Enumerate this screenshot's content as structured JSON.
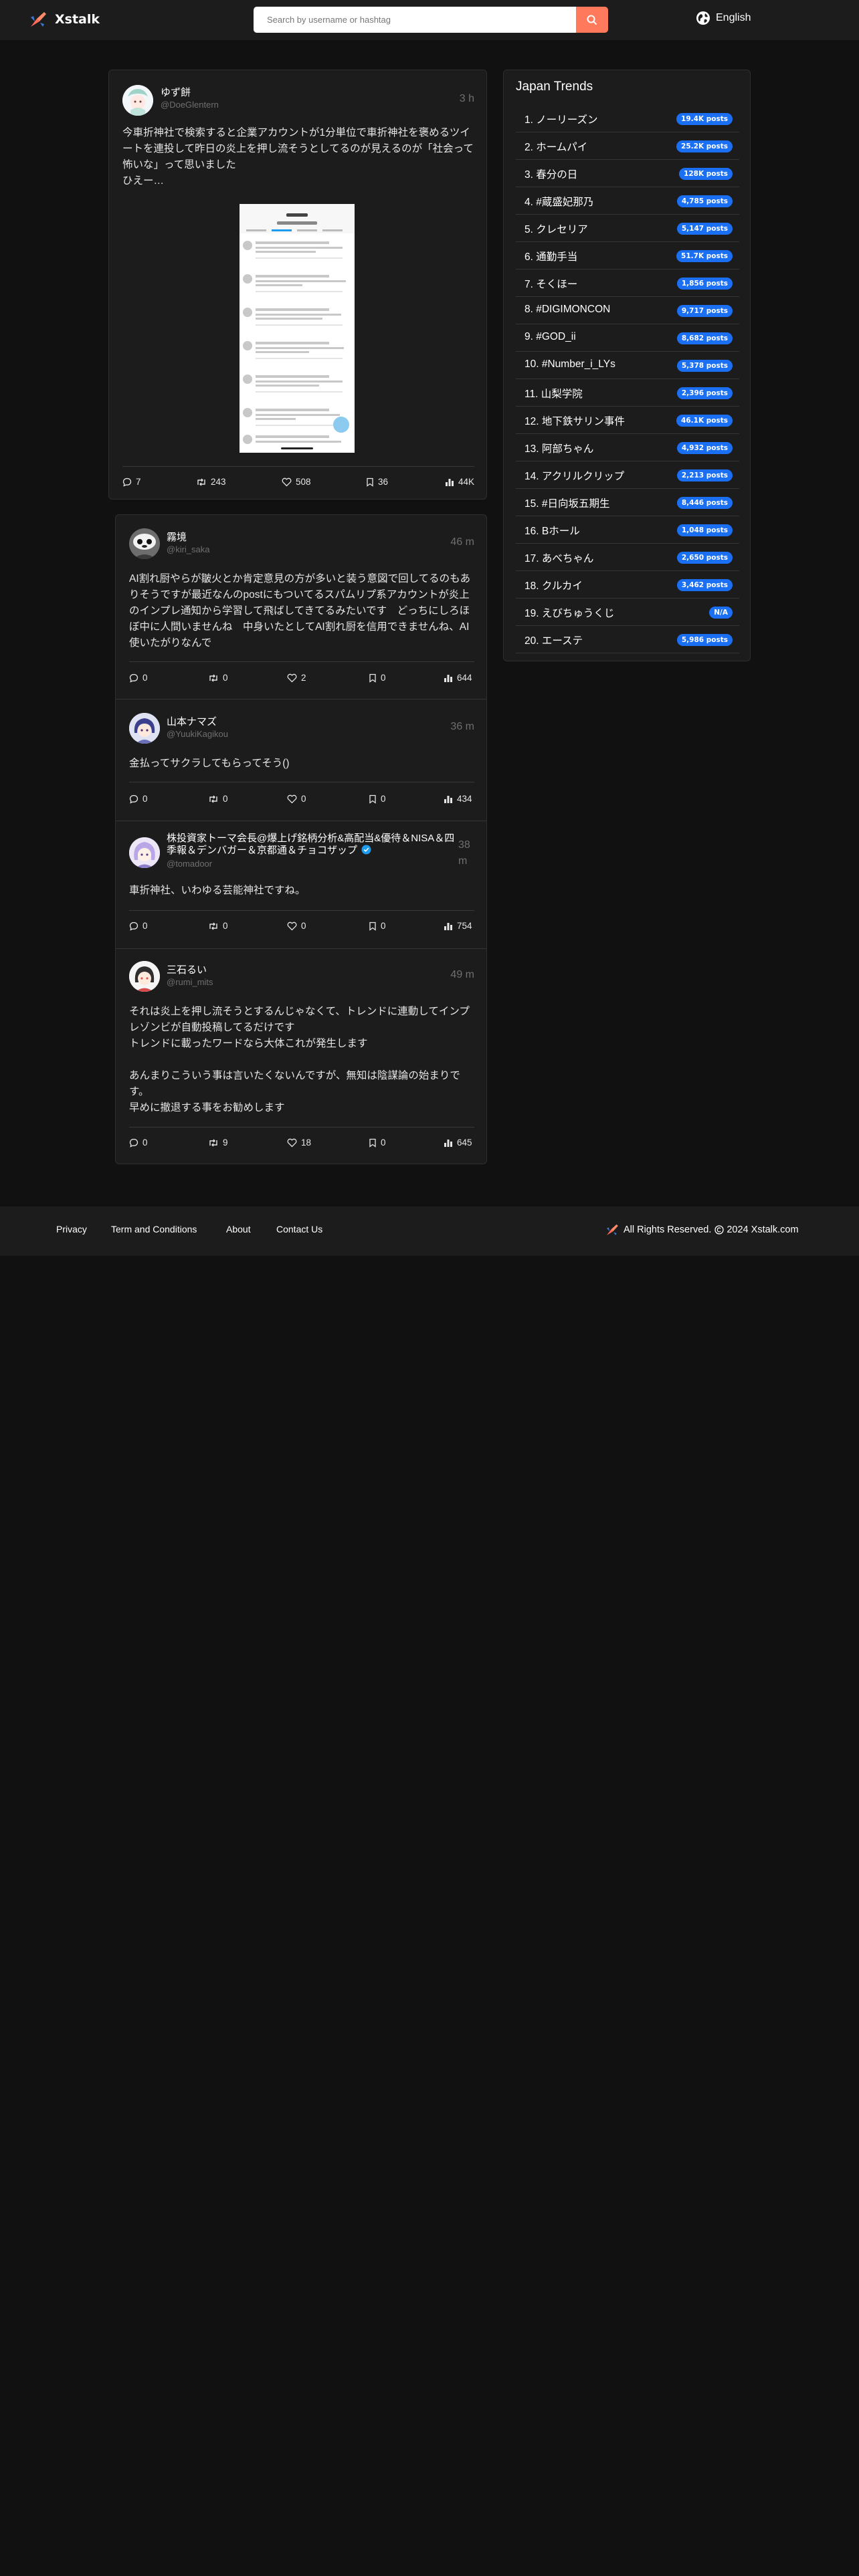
{
  "header": {
    "brand": "Xstalk",
    "search_placeholder": "Search by username or hashtag",
    "language": "English"
  },
  "posts": [
    {
      "name": "ゆず餅",
      "handle": "@DoeGlentern",
      "time": "3 h",
      "text": "今車折神社で検索すると企業アカウントが1分単位で車折神社を褒めるツイートを連投して昨日の炎上を押し流そうとしてるのが見えるのが「社会って怖いな」って思いました\nひえー…",
      "stats": {
        "replies": "7",
        "reposts": "243",
        "likes": "508",
        "bookmarks": "36",
        "views": "44K"
      }
    },
    {
      "name": "霧境",
      "handle": "@kiri_saka",
      "time": "46 m",
      "text": "AI割れ厨やらが皺火とか肯定意見の方が多いと装う意図で回してるのもありそうですが最近なんのpostにもついてるスパムリプ系アカウントが炎上のインプレ通知から学習して飛ばしてきてるみたいです　どっちにしろほぼ中に人間いませんね　中身いたとしてAI割れ厨を信用できませんね、AI使いたがりなんで",
      "stats": {
        "replies": "0",
        "reposts": "0",
        "likes": "2",
        "bookmarks": "0",
        "views": "644"
      }
    },
    {
      "name": "山本ナマズ",
      "handle": "@YuukiKagikou",
      "time": "36 m",
      "text": "金払ってサクラしてもらってそう()",
      "stats": {
        "replies": "0",
        "reposts": "0",
        "likes": "0",
        "bookmarks": "0",
        "views": "434"
      }
    },
    {
      "name": "株投資家トーマ会長@爆上げ銘柄分析&高配当&優待＆NISA＆四季報＆デンバガー＆京都通＆チョコザップ",
      "handle": "@tomadoor",
      "time": "38 m",
      "text": "車折神社、いわゆる芸能神社ですね。",
      "stats": {
        "replies": "0",
        "reposts": "0",
        "likes": "0",
        "bookmarks": "0",
        "views": "754"
      }
    },
    {
      "name": "三石るい",
      "handle": "@rumi_mits",
      "time": "49 m",
      "text": "それは炎上を押し流そうとするんじゃなくて、トレンドに連動してインプレゾンビが自動投稿してるだけです\nトレンドに載ったワードなら大体これが発生します\n\nあんまりこういう事は言いたくないんですが、無知は陰謀論の始まりです。\n早めに撤退する事をお勧めします",
      "stats": {
        "replies": "0",
        "reposts": "9",
        "likes": "18",
        "bookmarks": "0",
        "views": "645"
      }
    }
  ],
  "trends": {
    "title": "Japan Trends",
    "items": [
      {
        "label": "1. ノーリーズン",
        "count": "19.4K posts"
      },
      {
        "label": "2. ホームパイ",
        "count": "25.2K posts"
      },
      {
        "label": "3. 春分の日",
        "count": "128K posts"
      },
      {
        "label": "4. #蔵盛妃那乃",
        "count": "4,785 posts"
      },
      {
        "label": "5. クレセリア",
        "count": "5,147 posts"
      },
      {
        "label": "6. 通勤手当",
        "count": "51.7K posts"
      },
      {
        "label": "7. そくほー",
        "count": "1,856 posts"
      },
      {
        "label": "8. #DIGIMONCON",
        "count": "9,717 posts"
      },
      {
        "label": "9. #GOD_ii",
        "count": "8,682 posts"
      },
      {
        "label": "10. #Number_i_LYs",
        "count": "5,378 posts"
      },
      {
        "label": "11. 山梨学院",
        "count": "2,396 posts"
      },
      {
        "label": "12. 地下鉄サリン事件",
        "count": "46.1K posts"
      },
      {
        "label": "13. 阿部ちゃん",
        "count": "4,932 posts"
      },
      {
        "label": "14. アクリルクリップ",
        "count": "2,213 posts"
      },
      {
        "label": "15. #日向坂五期生",
        "count": "8,446 posts"
      },
      {
        "label": "16. Bホール",
        "count": "1,048 posts"
      },
      {
        "label": "17. あべちゃん",
        "count": "2,650 posts"
      },
      {
        "label": "18. クルカイ",
        "count": "3,462 posts"
      },
      {
        "label": "19. えびちゅうくじ",
        "count": "N/A"
      },
      {
        "label": "20. エーステ",
        "count": "5,986 posts"
      }
    ]
  },
  "footer": {
    "links": [
      "Privacy",
      "Term and Conditions",
      "About",
      "Contact Us"
    ],
    "rights": "All Rights Reserved.",
    "copyright": "2024 Xstalk.com"
  },
  "colors": {
    "accent": "#ff7a5c",
    "badge": "#1a6ff2",
    "verified": "#1d9bf0",
    "background": "#111111",
    "panel": "#1c1c1c"
  }
}
